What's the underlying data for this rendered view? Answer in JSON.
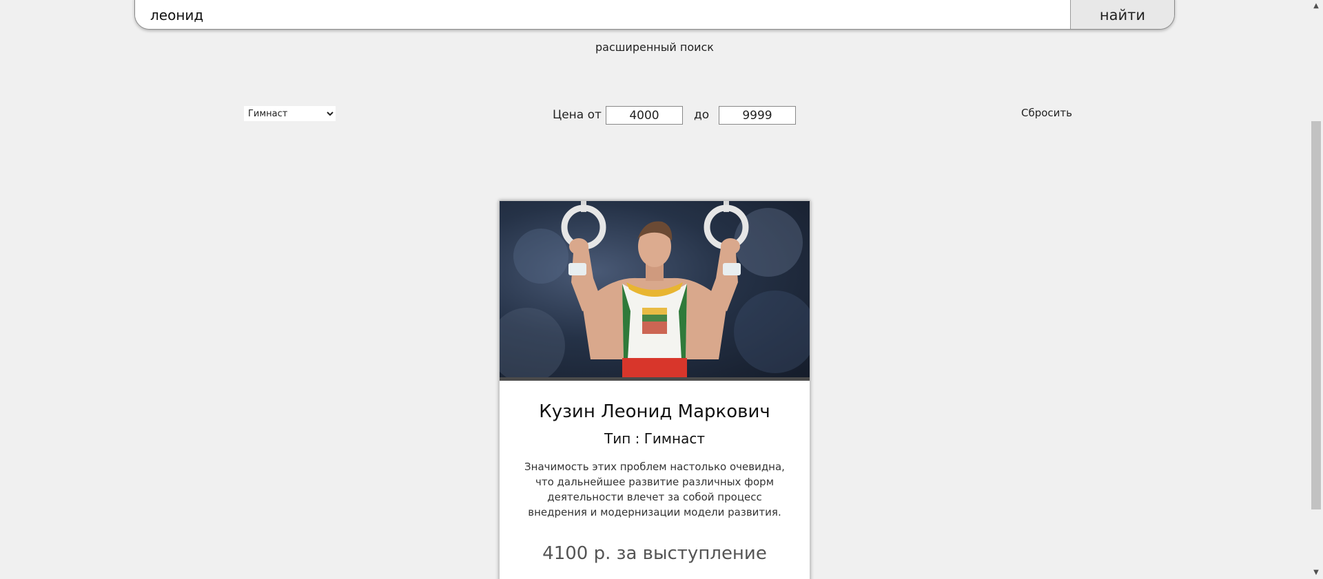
{
  "search": {
    "value": "леонид",
    "button_label": "найти",
    "advanced_label": "расширенный поиск"
  },
  "filters": {
    "type_selected": "Гимнаст",
    "price_from_label": "Цена от",
    "price_from_value": "4000",
    "price_to_label": "до",
    "price_to_value": "9999",
    "reset_label": "Сбросить"
  },
  "card": {
    "name": "Кузин Леонид Маркович",
    "type": "Тип : Гимнаст",
    "description": "Значимость этих проблем настолько очевидна, что дальнейшее развитие различных форм деятельности влечет за собой процесс внедрения и модернизации модели развития.",
    "price": "4100 р. за выступление"
  },
  "scrollbar": {
    "up_icon": "▲",
    "down_icon": "▼"
  }
}
